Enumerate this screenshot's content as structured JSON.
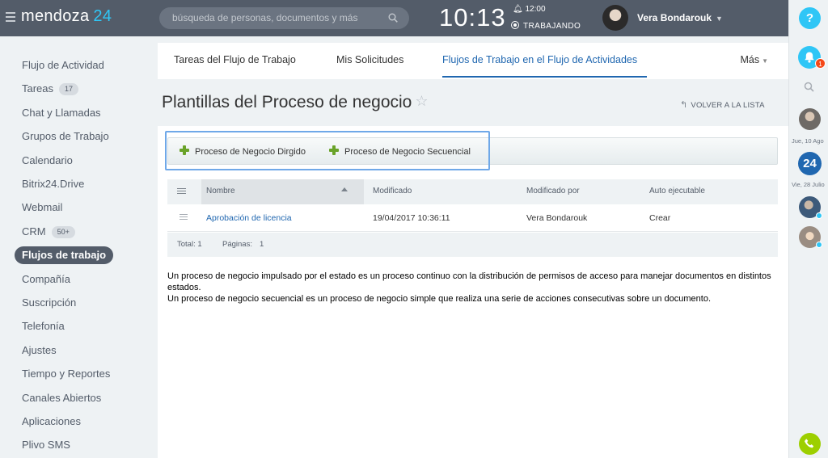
{
  "header": {
    "logo_text": "mendoza",
    "logo_number": "24",
    "search_placeholder": "búsqueda de personas, documentos y más",
    "clock": "10:13",
    "alarm": "12:00",
    "work_status": "TRABAJANDO",
    "user_name": "Vera Bondarouk"
  },
  "sidebar": {
    "items": [
      {
        "label": "Flujo de Actividad"
      },
      {
        "label": "Tareas",
        "counter": "17"
      },
      {
        "label": "Chat y Llamadas"
      },
      {
        "label": "Grupos de Trabajo"
      },
      {
        "label": "Calendario"
      },
      {
        "label": "Bitrix24.Drive"
      },
      {
        "label": "Webmail"
      },
      {
        "label": "CRM",
        "counter": "50+"
      },
      {
        "label": "Flujos de trabajo"
      },
      {
        "label": "Compañía"
      },
      {
        "label": "Suscripción"
      },
      {
        "label": "Telefonía"
      },
      {
        "label": "Ajustes"
      },
      {
        "label": "Tiempo y Reportes"
      },
      {
        "label": "Canales Abiertos"
      },
      {
        "label": "Aplicaciones"
      },
      {
        "label": "Plivo SMS"
      }
    ],
    "active_index": 8
  },
  "tabs": {
    "items": [
      "Tareas del Flujo de Trabajo",
      "Mis Solicitudes",
      "Flujos de Trabajo en el Flujo de Actividades"
    ],
    "active_index": 2,
    "more_label": "Más"
  },
  "page": {
    "title": "Plantillas del Proceso de negocio",
    "back_link": "VOLVER A LA LISTA"
  },
  "toolbar": {
    "add_directed": "Proceso de Negocio Dirgido",
    "add_sequential": "Proceso de Negocio Secuencial"
  },
  "grid": {
    "columns": [
      "Nombre",
      "Modificado",
      "Modificado por",
      "Auto ejecutable"
    ],
    "rows": [
      {
        "name": "Aprobación de licencia",
        "modified": "19/04/2017 10:36:11",
        "modified_by": "Vera Bondarouk",
        "autorun": "Crear"
      }
    ],
    "footer": {
      "total_label": "Total: 1",
      "pages_label": "Páginas:",
      "pages_value": "1"
    }
  },
  "description": {
    "line1": "Un proceso de negocio impulsado por el estado es un proceso continuo con la distribución de permisos de acceso para manejar documentos en distintos estados.",
    "line2": "Un proceso de negocio secuencial es un proceso de negocio simple que realiza una serie de acciones consecutivas sobre un documento."
  },
  "rightbar": {
    "help": "?",
    "notifications_count": "1",
    "brand_badge": "24",
    "date1": "Jue, 10 Ago",
    "date2": "Vie, 28 Julio"
  },
  "colors": {
    "topbar": "#535c69",
    "accent": "#2fc6f6",
    "link": "#2067b0",
    "plus_green": "#6aa329",
    "phone_green": "#9dcf00"
  }
}
